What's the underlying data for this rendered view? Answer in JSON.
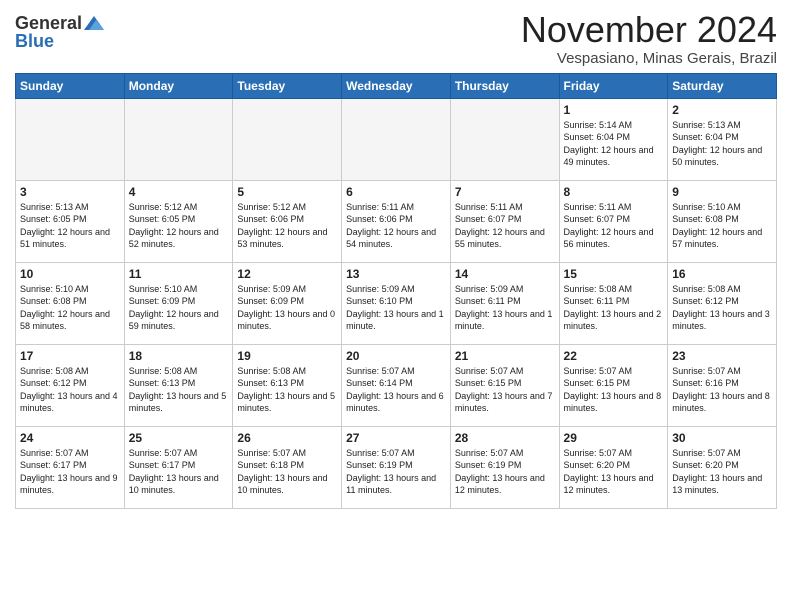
{
  "header": {
    "logo_general": "General",
    "logo_blue": "Blue",
    "month": "November 2024",
    "location": "Vespasiano, Minas Gerais, Brazil"
  },
  "weekdays": [
    "Sunday",
    "Monday",
    "Tuesday",
    "Wednesday",
    "Thursday",
    "Friday",
    "Saturday"
  ],
  "weeks": [
    [
      {
        "day": "",
        "empty": true
      },
      {
        "day": "",
        "empty": true
      },
      {
        "day": "",
        "empty": true
      },
      {
        "day": "",
        "empty": true
      },
      {
        "day": "",
        "empty": true
      },
      {
        "day": "1",
        "sunrise": "5:14 AM",
        "sunset": "6:04 PM",
        "daylight": "12 hours and 49 minutes."
      },
      {
        "day": "2",
        "sunrise": "5:13 AM",
        "sunset": "6:04 PM",
        "daylight": "12 hours and 50 minutes."
      }
    ],
    [
      {
        "day": "3",
        "sunrise": "5:13 AM",
        "sunset": "6:05 PM",
        "daylight": "12 hours and 51 minutes."
      },
      {
        "day": "4",
        "sunrise": "5:12 AM",
        "sunset": "6:05 PM",
        "daylight": "12 hours and 52 minutes."
      },
      {
        "day": "5",
        "sunrise": "5:12 AM",
        "sunset": "6:06 PM",
        "daylight": "12 hours and 53 minutes."
      },
      {
        "day": "6",
        "sunrise": "5:11 AM",
        "sunset": "6:06 PM",
        "daylight": "12 hours and 54 minutes."
      },
      {
        "day": "7",
        "sunrise": "5:11 AM",
        "sunset": "6:07 PM",
        "daylight": "12 hours and 55 minutes."
      },
      {
        "day": "8",
        "sunrise": "5:11 AM",
        "sunset": "6:07 PM",
        "daylight": "12 hours and 56 minutes."
      },
      {
        "day": "9",
        "sunrise": "5:10 AM",
        "sunset": "6:08 PM",
        "daylight": "12 hours and 57 minutes."
      }
    ],
    [
      {
        "day": "10",
        "sunrise": "5:10 AM",
        "sunset": "6:08 PM",
        "daylight": "12 hours and 58 minutes."
      },
      {
        "day": "11",
        "sunrise": "5:10 AM",
        "sunset": "6:09 PM",
        "daylight": "12 hours and 59 minutes."
      },
      {
        "day": "12",
        "sunrise": "5:09 AM",
        "sunset": "6:09 PM",
        "daylight": "13 hours and 0 minutes."
      },
      {
        "day": "13",
        "sunrise": "5:09 AM",
        "sunset": "6:10 PM",
        "daylight": "13 hours and 1 minute."
      },
      {
        "day": "14",
        "sunrise": "5:09 AM",
        "sunset": "6:11 PM",
        "daylight": "13 hours and 1 minute."
      },
      {
        "day": "15",
        "sunrise": "5:08 AM",
        "sunset": "6:11 PM",
        "daylight": "13 hours and 2 minutes."
      },
      {
        "day": "16",
        "sunrise": "5:08 AM",
        "sunset": "6:12 PM",
        "daylight": "13 hours and 3 minutes."
      }
    ],
    [
      {
        "day": "17",
        "sunrise": "5:08 AM",
        "sunset": "6:12 PM",
        "daylight": "13 hours and 4 minutes."
      },
      {
        "day": "18",
        "sunrise": "5:08 AM",
        "sunset": "6:13 PM",
        "daylight": "13 hours and 5 minutes."
      },
      {
        "day": "19",
        "sunrise": "5:08 AM",
        "sunset": "6:13 PM",
        "daylight": "13 hours and 5 minutes."
      },
      {
        "day": "20",
        "sunrise": "5:07 AM",
        "sunset": "6:14 PM",
        "daylight": "13 hours and 6 minutes."
      },
      {
        "day": "21",
        "sunrise": "5:07 AM",
        "sunset": "6:15 PM",
        "daylight": "13 hours and 7 minutes."
      },
      {
        "day": "22",
        "sunrise": "5:07 AM",
        "sunset": "6:15 PM",
        "daylight": "13 hours and 8 minutes."
      },
      {
        "day": "23",
        "sunrise": "5:07 AM",
        "sunset": "6:16 PM",
        "daylight": "13 hours and 8 minutes."
      }
    ],
    [
      {
        "day": "24",
        "sunrise": "5:07 AM",
        "sunset": "6:17 PM",
        "daylight": "13 hours and 9 minutes."
      },
      {
        "day": "25",
        "sunrise": "5:07 AM",
        "sunset": "6:17 PM",
        "daylight": "13 hours and 10 minutes."
      },
      {
        "day": "26",
        "sunrise": "5:07 AM",
        "sunset": "6:18 PM",
        "daylight": "13 hours and 10 minutes."
      },
      {
        "day": "27",
        "sunrise": "5:07 AM",
        "sunset": "6:19 PM",
        "daylight": "13 hours and 11 minutes."
      },
      {
        "day": "28",
        "sunrise": "5:07 AM",
        "sunset": "6:19 PM",
        "daylight": "13 hours and 12 minutes."
      },
      {
        "day": "29",
        "sunrise": "5:07 AM",
        "sunset": "6:20 PM",
        "daylight": "13 hours and 12 minutes."
      },
      {
        "day": "30",
        "sunrise": "5:07 AM",
        "sunset": "6:20 PM",
        "daylight": "13 hours and 13 minutes."
      }
    ]
  ]
}
